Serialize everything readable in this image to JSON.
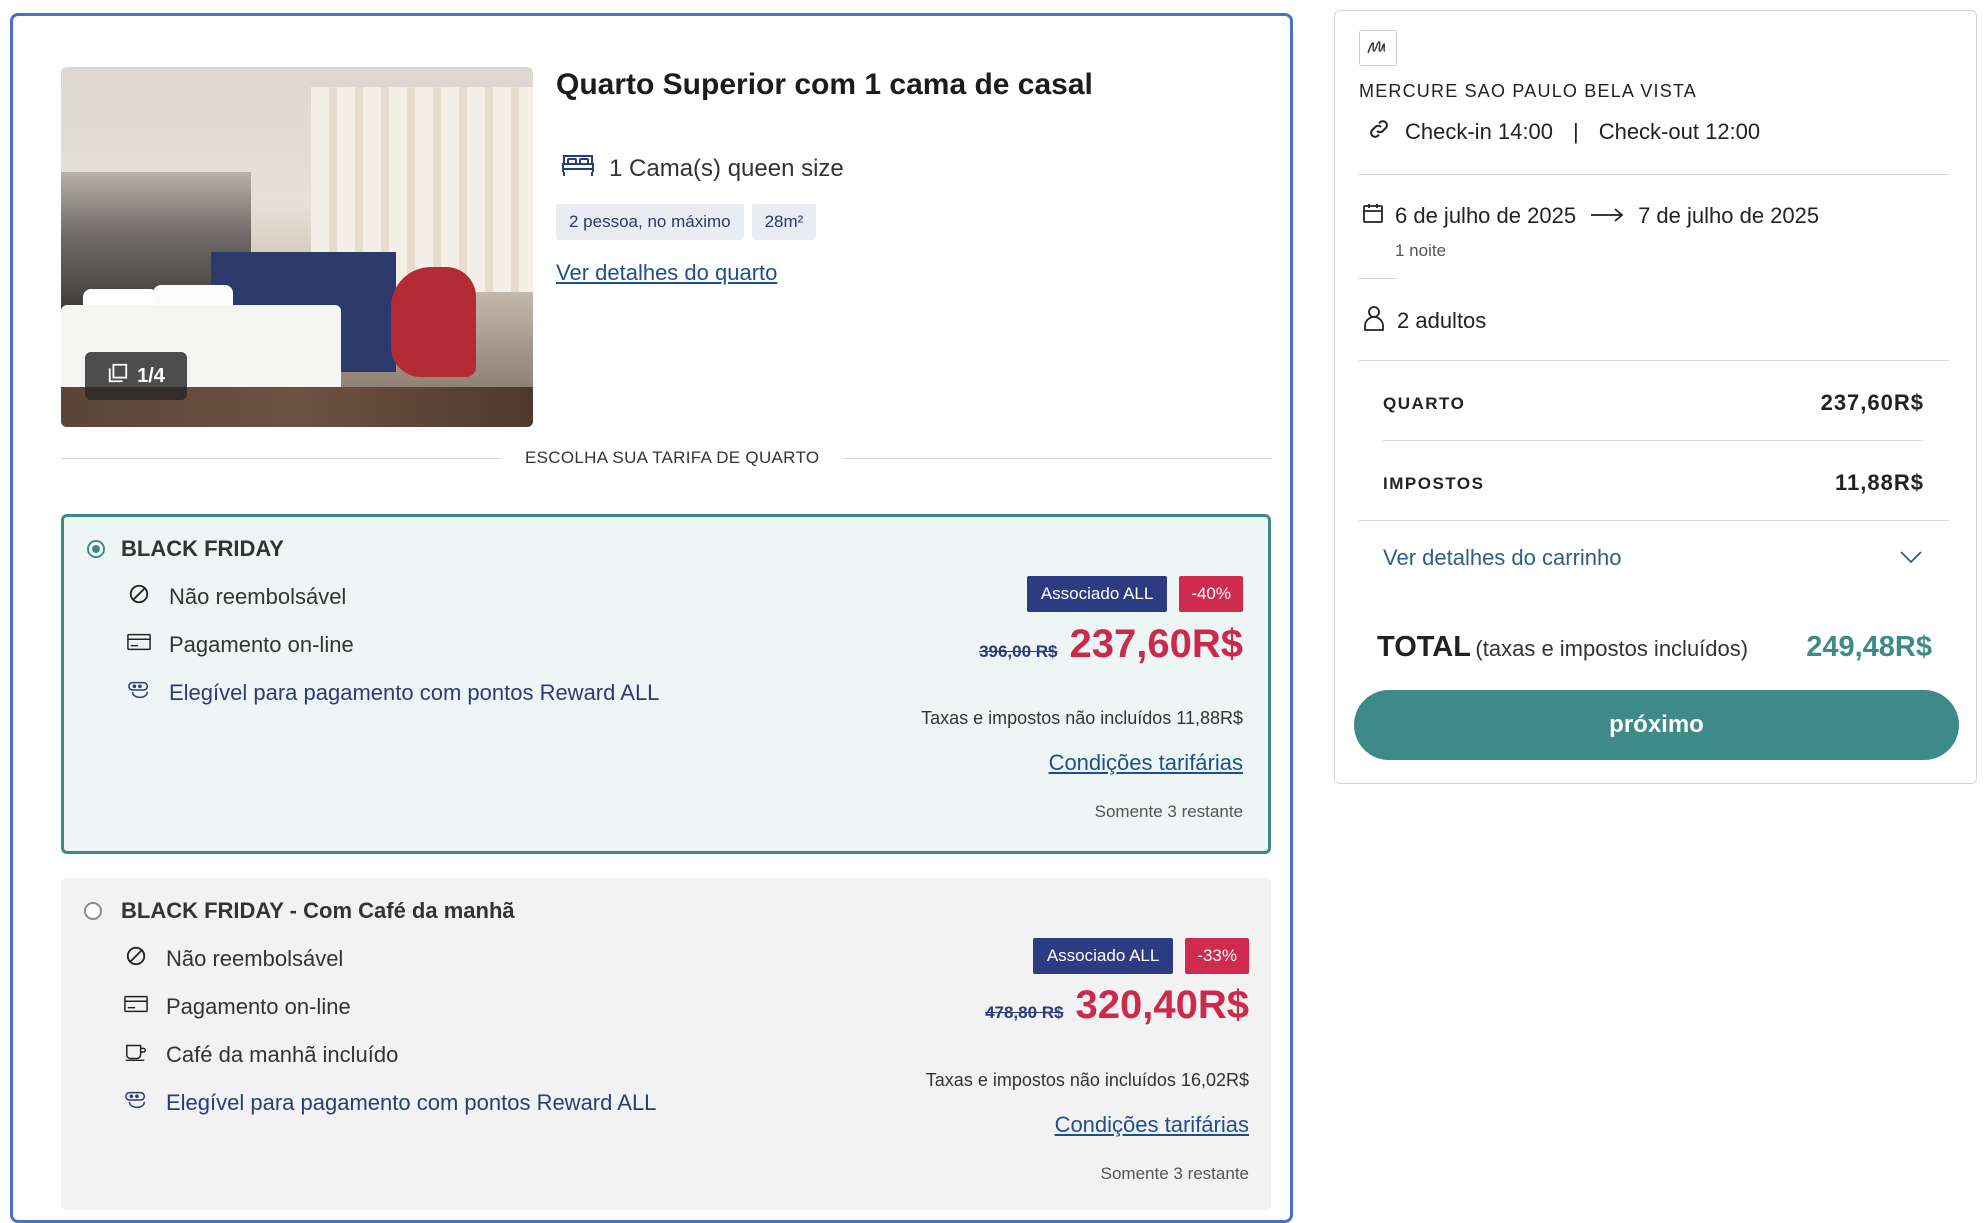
{
  "room": {
    "title": "Quarto Superior com 1 cama de casal",
    "bed": "1 Cama(s) queen size",
    "tags": [
      "2 pessoa, no máximo",
      "28m²"
    ],
    "details_link": "Ver detalhes do quarto",
    "photo_counter": "1/4"
  },
  "rate_section_label": "ESCOLHA SUA TARIFA DE QUARTO",
  "rates": [
    {
      "name": "BLACK FRIDAY",
      "selected": true,
      "features": [
        "Não reembolsável",
        "Pagamento on-line",
        "Elegível para pagamento com pontos Reward ALL"
      ],
      "member_badge": "Associado ALL",
      "discount_badge": "-40%",
      "old_price": "396,00 R$",
      "price": "237,60R$",
      "tax_note": "Taxas e impostos não incluídos 11,88R$",
      "conditions": "Condições tarifárias",
      "remaining": "Somente 3 restante"
    },
    {
      "name": "BLACK FRIDAY - Com Café da manhã",
      "selected": false,
      "features": [
        "Não reembolsável",
        "Pagamento on-line",
        "Café da manhã incluído",
        "Elegível para pagamento com pontos Reward ALL"
      ],
      "member_badge": "Associado ALL",
      "discount_badge": "-33%",
      "old_price": "478,80 R$",
      "price": "320,40R$",
      "tax_note": "Taxas e impostos não incluídos 16,02R$",
      "conditions": "Condições tarifárias",
      "remaining": "Somente 3 restante"
    }
  ],
  "cart": {
    "hotel_name": "MERCURE SAO PAULO BELA VISTA",
    "checkin": "Check-in 14:00",
    "pipe": "|",
    "checkout": "Check-out 12:00",
    "date_from": "6 de julho de 2025",
    "date_to": "7 de julho de 2025",
    "nights": "1 noite",
    "guests": "2 adultos",
    "room_label": "QUARTO",
    "room_value": "237,60R$",
    "tax_label": "IMPOSTOS",
    "tax_value": "11,88R$",
    "details_link": "Ver detalhes do carrinho",
    "total_label": "TOTAL",
    "total_sub": "(taxas e impostos incluídos)",
    "total_value": "249,48R$",
    "next_button": "próximo"
  },
  "colors": {
    "accent": "#3e8a88",
    "price_red": "#cc2a4c",
    "member_badge": "#2d3b83",
    "discount_badge": "#d02a4e",
    "card_border": "#4a72c4",
    "link": "#1f4f8c"
  },
  "icons": [
    "gallery-icon",
    "bed-icon",
    "no-refund-icon",
    "card-icon",
    "reward-icon",
    "coffee-icon",
    "link-icon",
    "calendar-icon",
    "arrow-right-icon",
    "person-icon",
    "chevron-down-icon",
    "hotel-logo"
  ]
}
